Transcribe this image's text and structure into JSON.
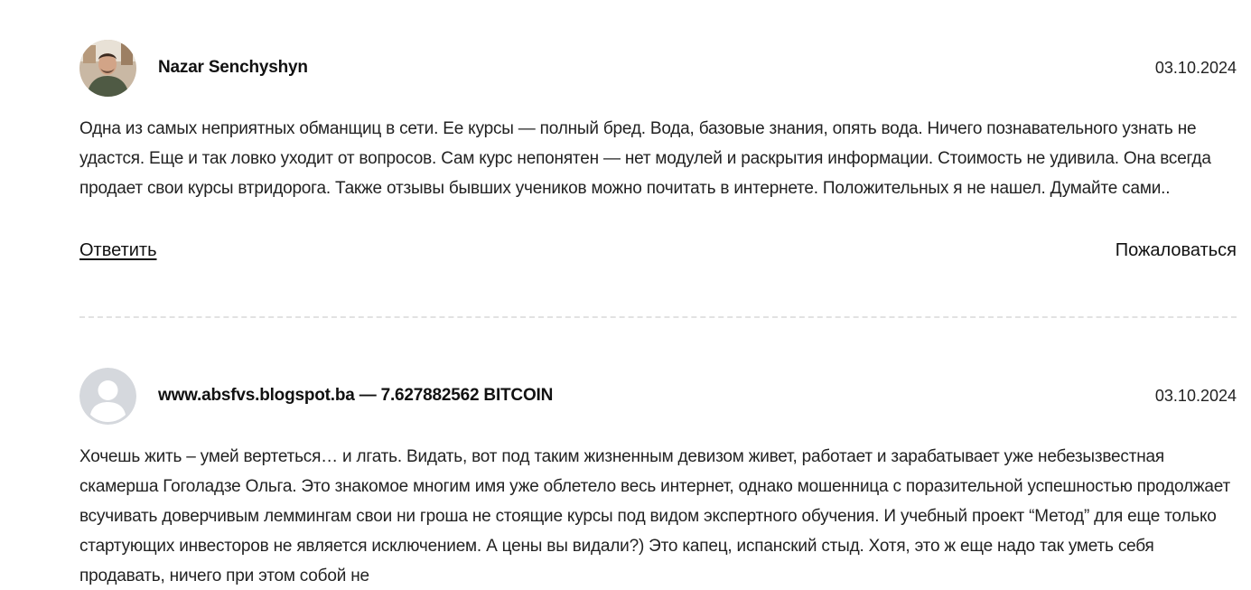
{
  "comments": [
    {
      "author": "Nazar Senchyshyn",
      "date": "03.10.2024",
      "avatar": "user-photo",
      "text": "Одна из самых неприятных обманщиц в сети. Ее курсы — полный бред. Вода, базовые знания, опять вода. Ничего познавательного узнать не удастся. Еще и так ловко уходит от вопросов. Сам курс непонятен — нет модулей и раскрытия информации. Стоимость не удивила. Она всегда продает свои курсы втридорога. Также отзывы бывших учеников можно почитать в интернете. Положительных я не нашел. Думайте сами..",
      "reply_label": "Ответить",
      "report_label": "Пожаловаться"
    },
    {
      "author": "www.absfvs.blogspot.ba — 7.627882562 BITCOIN",
      "date": "03.10.2024",
      "avatar": "default-user-icon",
      "text": "Хочешь жить – умей вертеться… и лгать. Видать, вот под таким жизненным девизом живет, работает и зарабатывает уже небезызвестная скамерша Гоголадзе Ольга. Это знакомое многим имя уже облетело весь интернет, однако мошенница с поразительной успешностью продолжает всучивать доверчивым леммингам свои ни гроша не стоящие курсы под видом экспертного обучения. И учебный проект “Метод” для еще только стартующих инвесторов не является исключением. А цены вы видали?) Это капец, испанский стыд. Хотя, это ж еще надо так уметь себя продавать, ничего при этом собой не"
    }
  ],
  "colors": {
    "text": "#222222",
    "divider": "#e2e2e2",
    "default_avatar_bg": "#d5d8dd",
    "default_avatar_fg": "#ffffff"
  }
}
